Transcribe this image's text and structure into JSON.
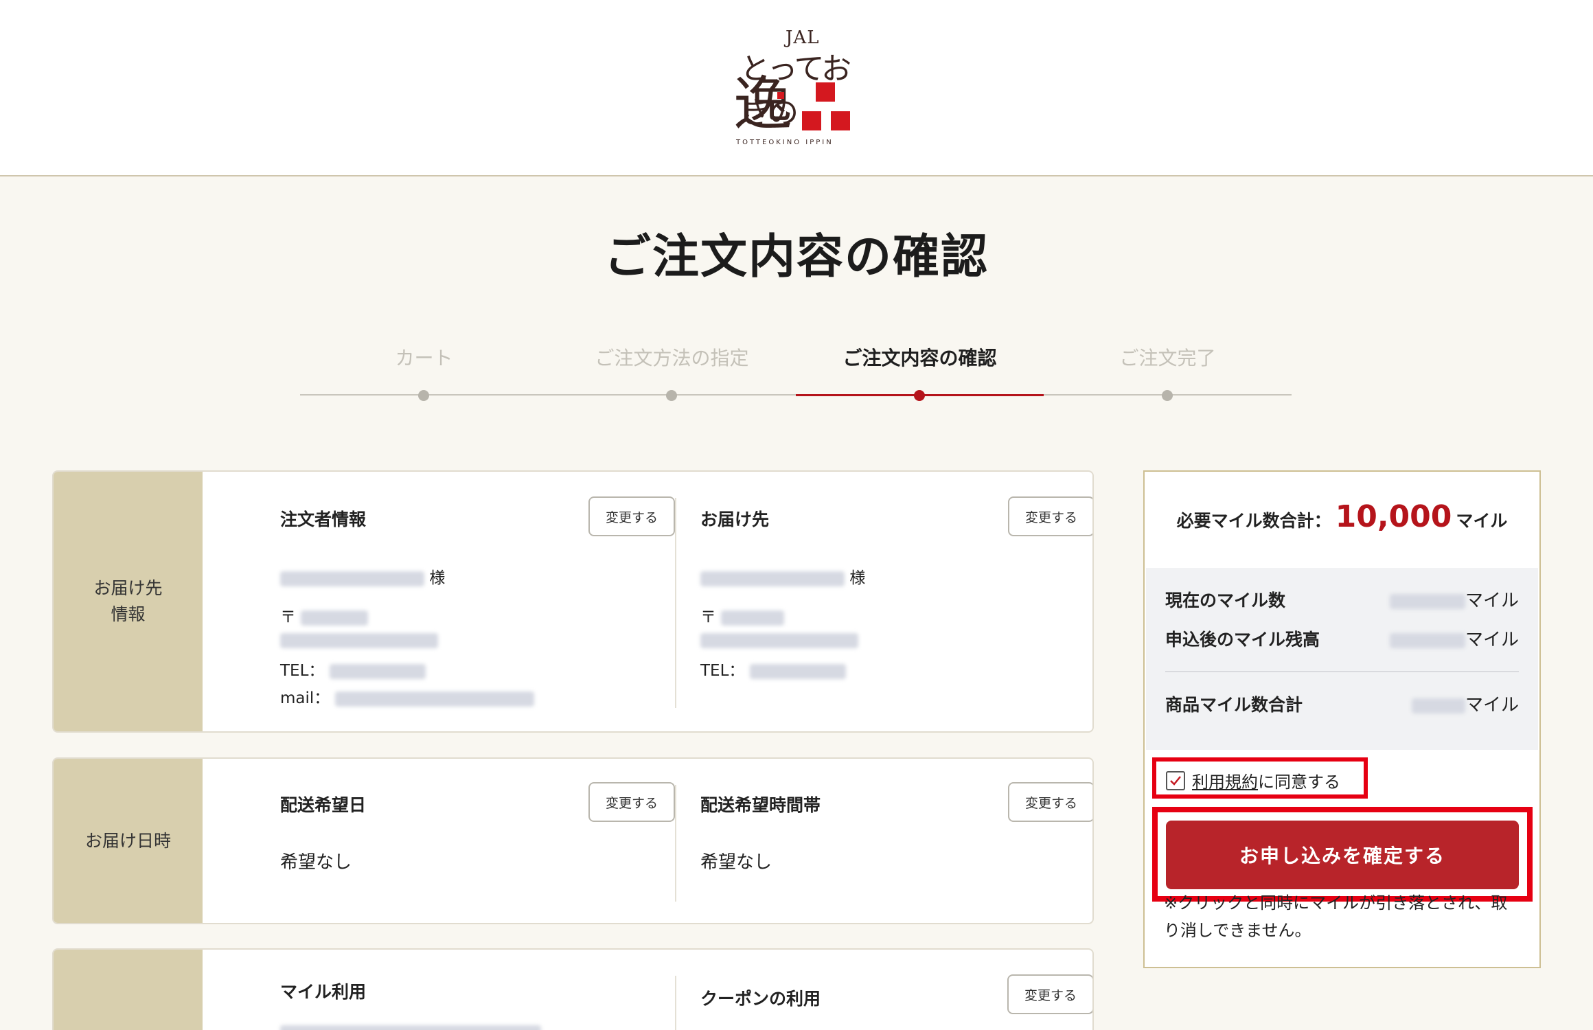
{
  "header": {
    "logo": {
      "brand": "JAL",
      "script": "とっておきの",
      "kanji": "逸",
      "subtitle": "TOTTEOKINO IPPIN"
    }
  },
  "page": {
    "title": "ご注文内容の確認"
  },
  "stepper": {
    "steps": [
      {
        "label": "カート",
        "state": "done"
      },
      {
        "label": "ご注文方法の指定",
        "state": "done"
      },
      {
        "label": "ご注文内容の確認",
        "state": "current"
      },
      {
        "label": "ご注文完了",
        "state": "upcoming"
      }
    ],
    "accent": "#b5141b"
  },
  "delivery_info": {
    "side_label_line1": "お届け先",
    "side_label_line2": "情報",
    "orderer": {
      "title": "注文者情報",
      "change": "変更する",
      "honorific": "様",
      "postal_prefix": "〒",
      "tel_label": "TEL：",
      "mail_label": "mail："
    },
    "destination": {
      "title": "お届け先",
      "change": "変更する",
      "honorific": "様",
      "postal_prefix": "〒",
      "tel_label": "TEL："
    }
  },
  "delivery_time": {
    "side_label": "お届け日時",
    "date": {
      "title": "配送希望日",
      "change": "変更する",
      "value": "希望なし"
    },
    "slot": {
      "title": "配送希望時間帯",
      "change": "変更する",
      "value": "希望なし"
    }
  },
  "payment": {
    "miles": {
      "title": "マイル利用"
    },
    "coupon": {
      "title": "クーポンの利用",
      "change": "変更する"
    }
  },
  "summary": {
    "total_label": "必要マイル数合計：",
    "total_value": "10,000",
    "total_unit": "マイル",
    "rows": [
      {
        "label": "現在のマイル数",
        "unit": "マイル"
      },
      {
        "label": "申込後のマイル残高",
        "unit": "マイル"
      },
      {
        "label": "商品マイル数合計",
        "unit": "マイル"
      }
    ],
    "agree": {
      "checked": true,
      "link": "利用規約",
      "rest": "に同意する"
    },
    "confirm_button": "お申し込みを確定する",
    "note": "※クリックと同時にマイルが引き落とされ、取り消しできません。",
    "accent": "#b8242a",
    "highlight": "#e60012"
  }
}
